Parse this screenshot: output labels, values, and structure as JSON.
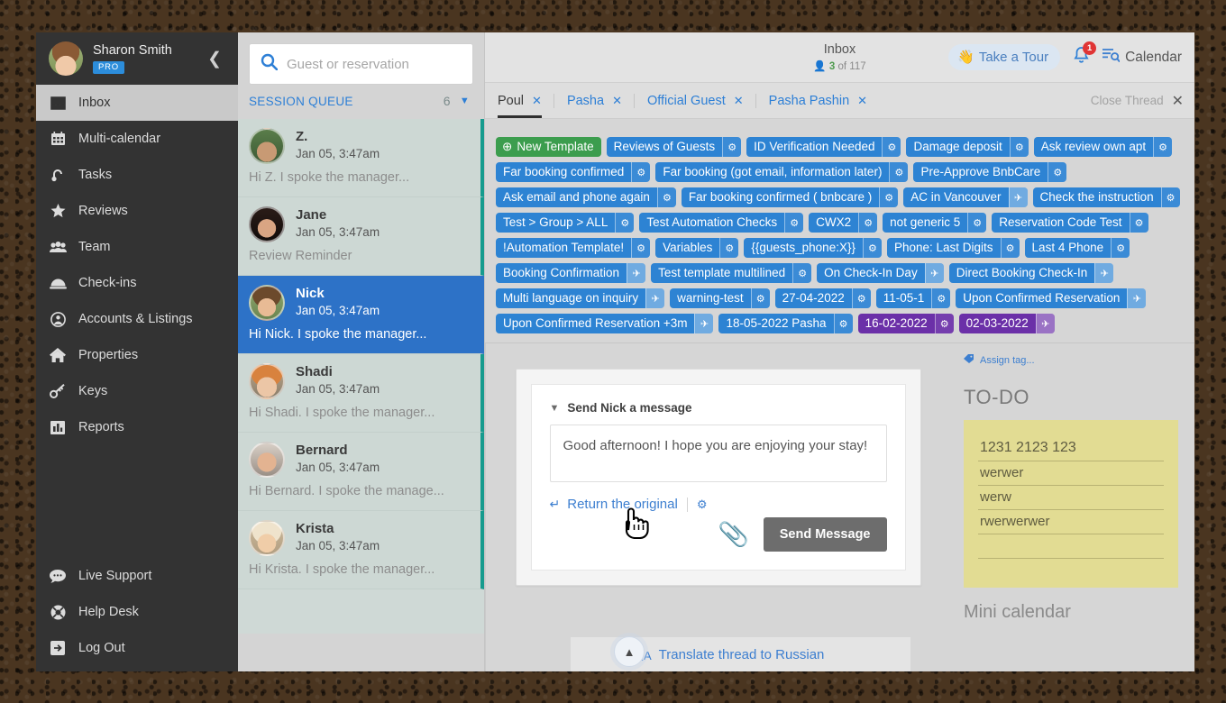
{
  "sidebar": {
    "user": {
      "name": "Sharon Smith",
      "badge": "PRO"
    },
    "collapse_icon": "chevron-left-icon",
    "items": [
      {
        "label": "Inbox",
        "icon": "inbox-icon",
        "active": true
      },
      {
        "label": "Multi-calendar",
        "icon": "calendar-icon",
        "active": false
      },
      {
        "label": "Tasks",
        "icon": "tasks-icon",
        "active": false
      },
      {
        "label": "Reviews",
        "icon": "star-icon",
        "active": false
      },
      {
        "label": "Team",
        "icon": "people-icon",
        "active": false
      },
      {
        "label": "Check-ins",
        "icon": "bell-desk-icon",
        "active": false
      },
      {
        "label": "Accounts & Listings",
        "icon": "user-circle-icon",
        "active": false
      },
      {
        "label": "Properties",
        "icon": "home-icon",
        "active": false
      },
      {
        "label": "Keys",
        "icon": "key-icon",
        "active": false
      },
      {
        "label": "Reports",
        "icon": "bar-chart-icon",
        "active": false
      }
    ],
    "bottom_items": [
      {
        "label": "Live Support",
        "icon": "chat-bubble-icon"
      },
      {
        "label": "Help Desk",
        "icon": "life-ring-icon"
      },
      {
        "label": "Log Out",
        "icon": "logout-icon"
      }
    ]
  },
  "search": {
    "placeholder": "Guest or reservation",
    "icon": "search-icon"
  },
  "queue": {
    "title": "SESSION QUEUE",
    "count": "6",
    "chevron": "chevron-down-icon",
    "threads": [
      {
        "name": "Z.",
        "date": "Jan 05, 3:47am",
        "preview": "Hi Z. I spoke the manager...",
        "selected": false
      },
      {
        "name": "Jane",
        "date": "Jan 05, 3:47am",
        "preview": "Review Reminder",
        "selected": false
      },
      {
        "name": "Nick",
        "date": "Jan 05, 3:47am",
        "preview": "Hi Nick. I spoke the manager...",
        "selected": true
      },
      {
        "name": "Shadi",
        "date": "Jan 05, 3:47am",
        "preview": "Hi Shadi. I spoke the manager...",
        "selected": false
      },
      {
        "name": "Bernard",
        "date": "Jan 05, 3:47am",
        "preview": "Hi Bernard. I spoke the manage...",
        "selected": false
      },
      {
        "name": "Krista",
        "date": "Jan 05, 3:47am",
        "preview": "Hi Krista. I spoke the manager...",
        "selected": false
      }
    ]
  },
  "topbar": {
    "title": "Inbox",
    "count_icon": "person-icon",
    "count_current": "3",
    "count_rest": " of 117",
    "take_a_tour": "Take a Tour",
    "tour_icon": "waving-hand-icon",
    "bell_icon": "bell-icon",
    "bell_badge": "1",
    "calendar_label": "Calendar",
    "calendar_icon": "calendar-search-icon"
  },
  "tabs": {
    "items": [
      {
        "label": "Poul",
        "active": true
      },
      {
        "label": "Pasha",
        "active": false
      },
      {
        "label": "Official Guest",
        "active": false
      },
      {
        "label": "Pasha Pashin",
        "active": false
      }
    ],
    "close_thread": "Close Thread",
    "close_icon": "close-icon"
  },
  "tags": [
    {
      "label": "New Template",
      "style": "green",
      "btn": "none",
      "plus": true
    },
    {
      "label": "Reviews of Guests",
      "style": "blue",
      "btn": "gear"
    },
    {
      "label": "ID Verification Needed",
      "style": "blue",
      "btn": "gear"
    },
    {
      "label": "Damage deposit",
      "style": "blue",
      "btn": "gear"
    },
    {
      "label": "Ask review own apt",
      "style": "blue",
      "btn": "gear"
    },
    {
      "label": "Far booking confirmed",
      "style": "blue",
      "btn": "gear"
    },
    {
      "label": "Far booking (got email, information later)",
      "style": "blue",
      "btn": "gear"
    },
    {
      "label": "Pre-Approve BnbCare",
      "style": "blue",
      "btn": "gear"
    },
    {
      "label": "Ask email and phone again",
      "style": "blue",
      "btn": "gear"
    },
    {
      "label": "Far booking confirmed ( bnbcare )",
      "style": "blue",
      "btn": "gear"
    },
    {
      "label": "AC in Vancouver",
      "style": "blue",
      "btn": "plane"
    },
    {
      "label": "Check the instruction",
      "style": "blue",
      "btn": "gear"
    },
    {
      "label": "Test > Group > ALL",
      "style": "blue",
      "btn": "gear"
    },
    {
      "label": "Test Automation Checks",
      "style": "blue",
      "btn": "gear"
    },
    {
      "label": "CWX2",
      "style": "blue",
      "btn": "gear"
    },
    {
      "label": "not generic 5",
      "style": "blue",
      "btn": "gear"
    },
    {
      "label": "Reservation Code Test",
      "style": "blue",
      "btn": "gear"
    },
    {
      "label": "!Automation Template!",
      "style": "blue",
      "btn": "gear"
    },
    {
      "label": "Variables",
      "style": "blue",
      "btn": "gear"
    },
    {
      "label": "{{guests_phone:X}}",
      "style": "blue",
      "btn": "gear"
    },
    {
      "label": "Phone: Last Digits",
      "style": "blue",
      "btn": "gear"
    },
    {
      "label": "Last 4 Phone",
      "style": "blue",
      "btn": "gear"
    },
    {
      "label": "Booking Confirmation",
      "style": "blue",
      "btn": "plane"
    },
    {
      "label": "Test template multilined",
      "style": "blue",
      "btn": "gear"
    },
    {
      "label": "On Check-In Day",
      "style": "blue",
      "btn": "plane"
    },
    {
      "label": "Direct Booking Check-In",
      "style": "blue",
      "btn": "plane"
    },
    {
      "label": "Multi language on inquiry",
      "style": "blue",
      "btn": "plane"
    },
    {
      "label": "warning-test",
      "style": "blue",
      "btn": "gear"
    },
    {
      "label": "27-04-2022",
      "style": "blue",
      "btn": "gear"
    },
    {
      "label": "11-05-1",
      "style": "blue",
      "btn": "gear"
    },
    {
      "label": "Upon Confirmed Reservation",
      "style": "blue",
      "btn": "plane"
    },
    {
      "label": "Upon Confirmed Reservation +3m",
      "style": "blue",
      "btn": "plane"
    },
    {
      "label": "18-05-2022 Pasha",
      "style": "blue",
      "btn": "gear"
    },
    {
      "label": "16-02-2022",
      "style": "purple",
      "btn": "gear"
    },
    {
      "label": "02-03-2022",
      "style": "purple",
      "btn": "plane"
    }
  ],
  "composer": {
    "header": "Send Nick a message",
    "header_icon": "chevron-down-icon",
    "message": "Good afternoon! I hope you are enjoying your stay!",
    "return_original": "Return the original",
    "return_icon": "undo-icon",
    "gear_icon": "gear-icon",
    "attach_icon": "paperclip-icon",
    "send_label": "Send Message"
  },
  "translate": {
    "label": "Translate thread to Russian",
    "icon": "translate-icon",
    "collapse_icon": "chevron-up-icon"
  },
  "rightpane": {
    "assign_tag": "Assign tag...",
    "assign_tag_icon": "tag-icon",
    "todo_title": "TO-DO",
    "todo_items": [
      "1231 2123 123",
      "werwer",
      "werw",
      "rwerwerwer",
      ""
    ],
    "mini_calendar": "Mini calendar"
  },
  "colors": {
    "accent_blue": "#2d7fd6",
    "tag_blue": "#2d83d3",
    "tag_purple": "#6b30a8",
    "tag_green": "#3c9d4e",
    "selected_thread": "#2d72c7",
    "queue_accent": "#169b8e",
    "note_yellow": "#e2dc93",
    "badge_red": "#e03535",
    "sidebar_dark": "#333333"
  }
}
